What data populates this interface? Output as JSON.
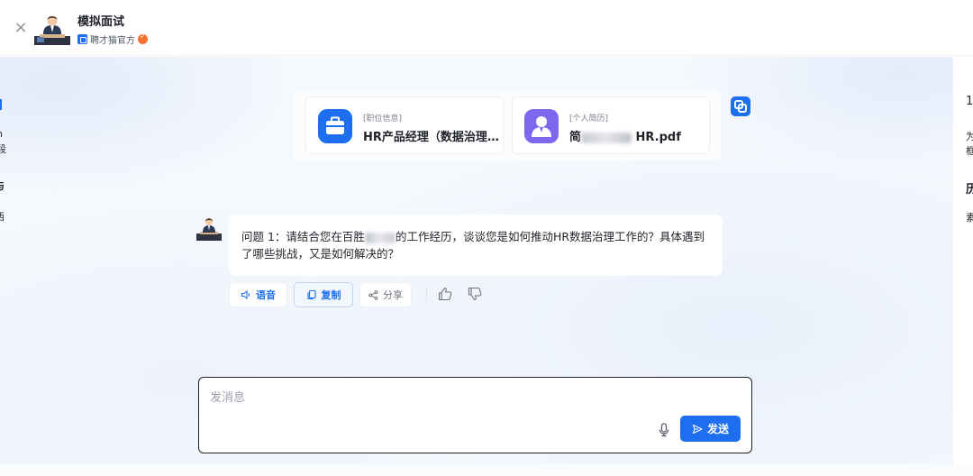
{
  "header": {
    "close_icon": "×",
    "title": "模拟面试",
    "official_label": "聘才猫官方"
  },
  "cards": {
    "job": {
      "tag": "[职位信息]",
      "title": "HR产品经理（数据治理…"
    },
    "resume": {
      "tag": "[个人简历]",
      "title_prefix": "简",
      "title_suffix": "HR.pdf"
    }
  },
  "message": {
    "prefix": "问题 1：请结合您在百胜",
    "suffix": "的工作经历，谈谈您是如何推动HR数据治理工作的？具体遇到了哪些挑战，又是如何解决的？"
  },
  "actions": {
    "voice": "语音",
    "copy": "复制",
    "share": "分享"
  },
  "input": {
    "placeholder": "发消息",
    "send_label": "发送"
  },
  "side": {
    "left": [
      "h",
      "段",
      "与",
      "西"
    ],
    "right": [
      "1",
      "为",
      "框",
      "历",
      "素"
    ]
  },
  "colors": {
    "accent": "#1e6ff0",
    "resume_icon": "#7b68ee",
    "verified": "#f5722d"
  }
}
